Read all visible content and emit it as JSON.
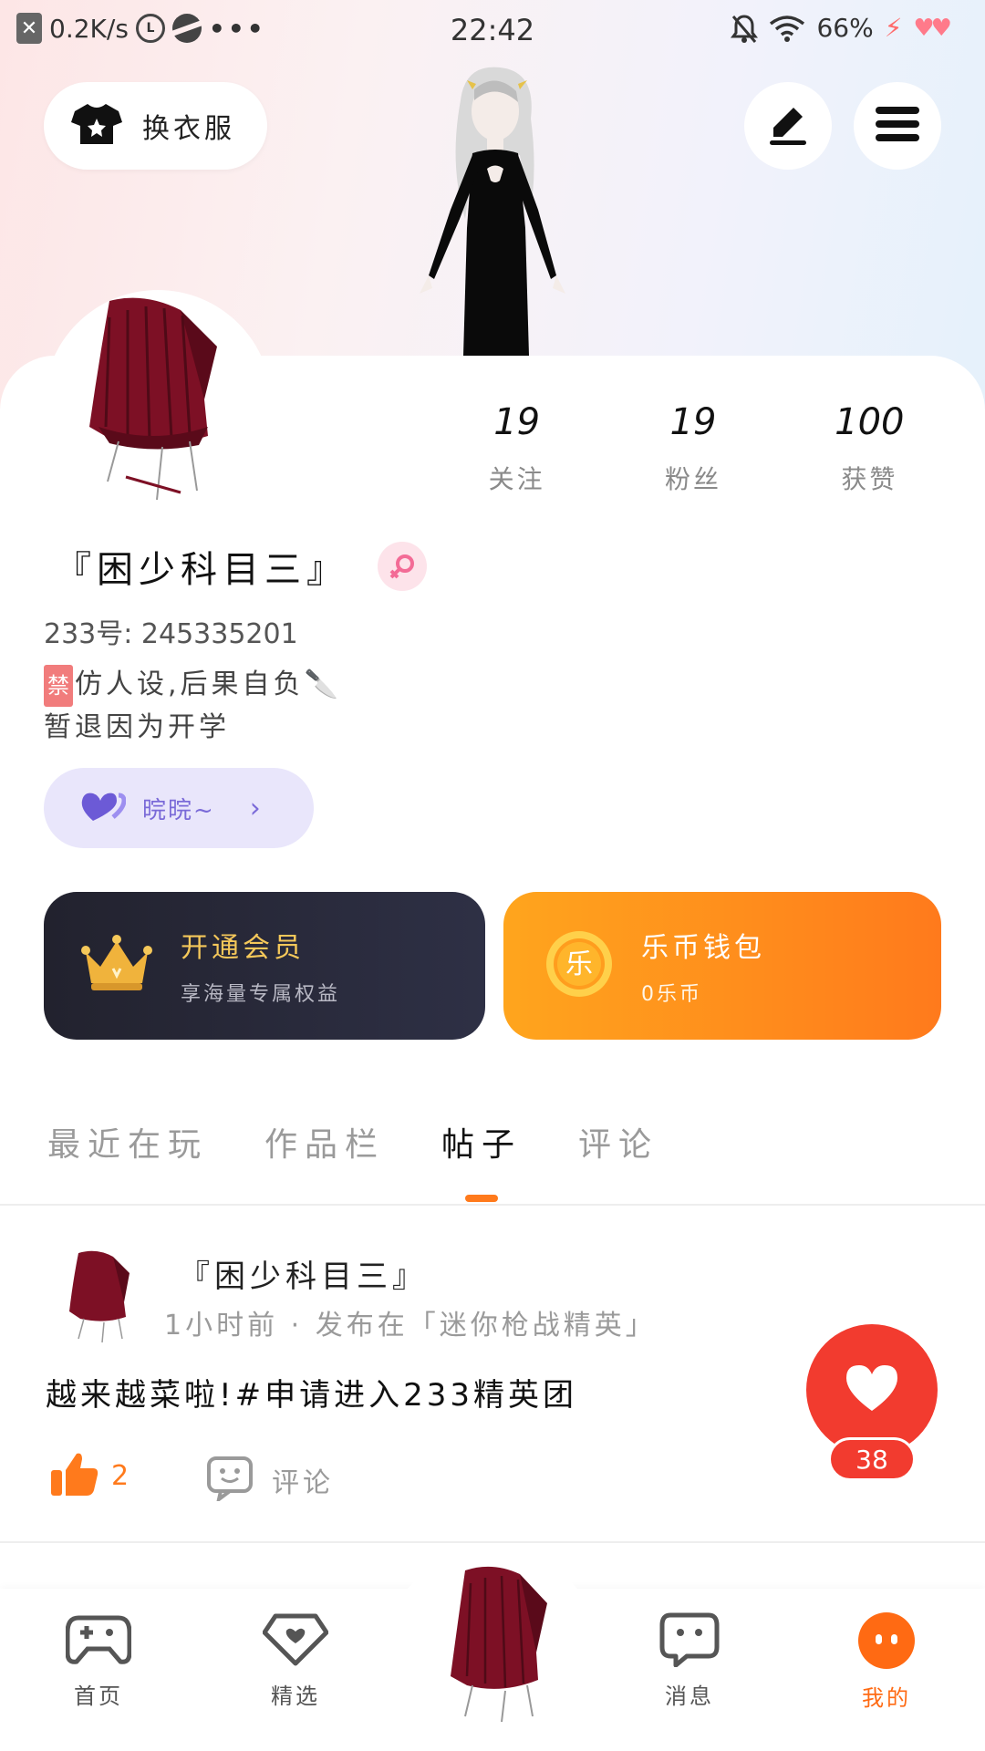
{
  "status_bar": {
    "speed": "0.2K/s",
    "time": "22:42",
    "battery": "66%"
  },
  "header": {
    "outfit_label": "换衣服"
  },
  "profile": {
    "stats": [
      {
        "value": "19",
        "label": "关注"
      },
      {
        "value": "19",
        "label": "粉丝"
      },
      {
        "value": "100",
        "label": "获赞"
      }
    ],
    "nickname": "『困少科目三』",
    "id_text": "233号: 245335201",
    "bio_tag": "禁",
    "bio_line1": "仿人设,后果自负🔪",
    "bio_line2": "暂退因为开学",
    "feeling": "晥晥~"
  },
  "cards": {
    "vip_title": "开通会员",
    "vip_sub": "享海量专属权益",
    "wallet_title": "乐币钱包",
    "wallet_sub": "0乐币",
    "wallet_coin": "乐"
  },
  "tabs": [
    {
      "label": "最近在玩"
    },
    {
      "label": "作品栏"
    },
    {
      "label": "帖子"
    },
    {
      "label": "评论"
    }
  ],
  "post": {
    "author": "『困少科目三』",
    "meta": "1小时前 · 发布在「迷你枪战精英」",
    "content": "越来越菜啦!#申请进入233精英团",
    "likes": "2",
    "comment_label": "评论"
  },
  "fab": {
    "heart_count": "38"
  },
  "bottom_nav": [
    {
      "label": "首页"
    },
    {
      "label": "精选"
    },
    {
      "label": "消息"
    },
    {
      "label": "我的"
    }
  ],
  "colors": {
    "accent": "#ff7a1c",
    "heart": "#f23b2f",
    "vip_gold": "#f5c85a"
  }
}
